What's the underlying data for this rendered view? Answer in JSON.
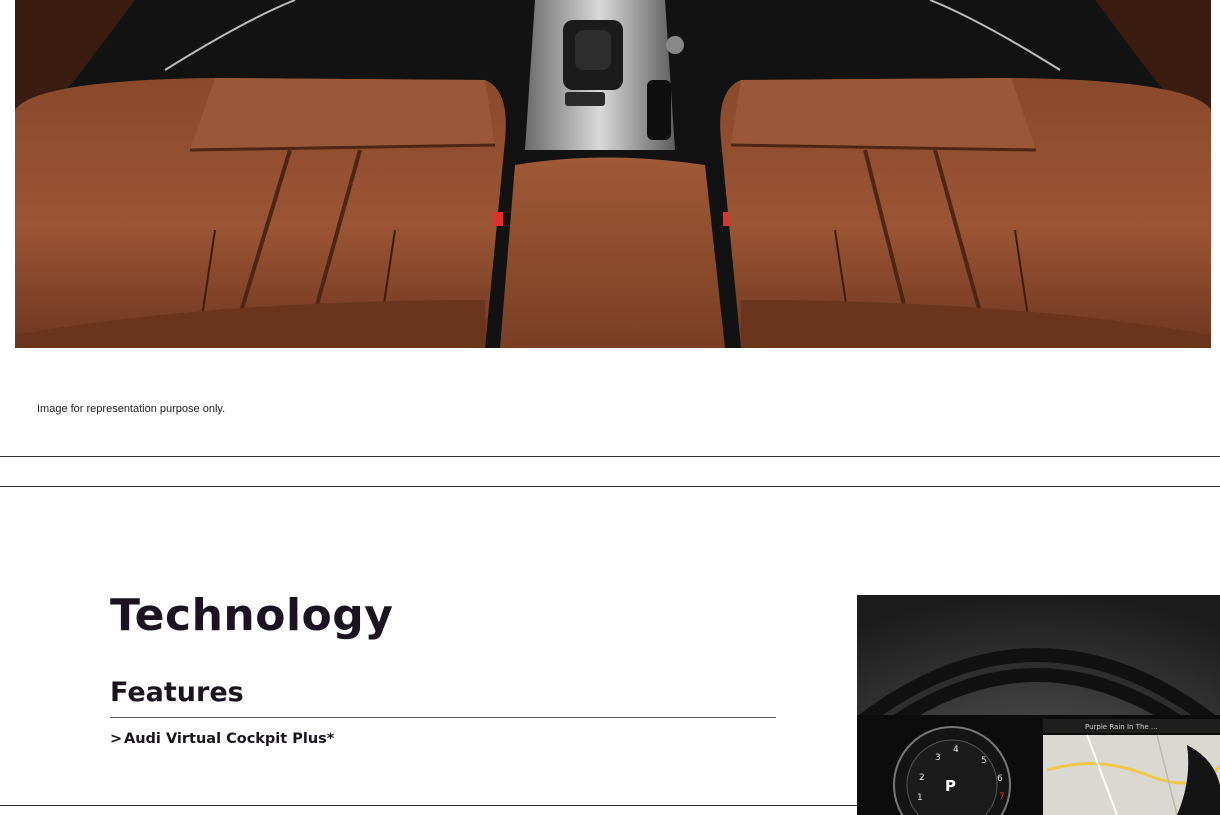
{
  "interior_section": {
    "image_alt": "Audi interior with brown leather seats",
    "caption": "Image for representation purpose only."
  },
  "technology_section": {
    "title": "Technology",
    "features_heading": "Features",
    "features": [
      {
        "chevron": ">",
        "label": "Audi Virtual Cockpit Plus*"
      }
    ],
    "image_alt": "Audi virtual cockpit instrument cluster"
  },
  "cockpit_display": {
    "gear": "P",
    "media_text": "Purple Rain In The ...",
    "dial_numbers": [
      "1",
      "2",
      "3",
      "4",
      "5",
      "6",
      "7"
    ]
  }
}
